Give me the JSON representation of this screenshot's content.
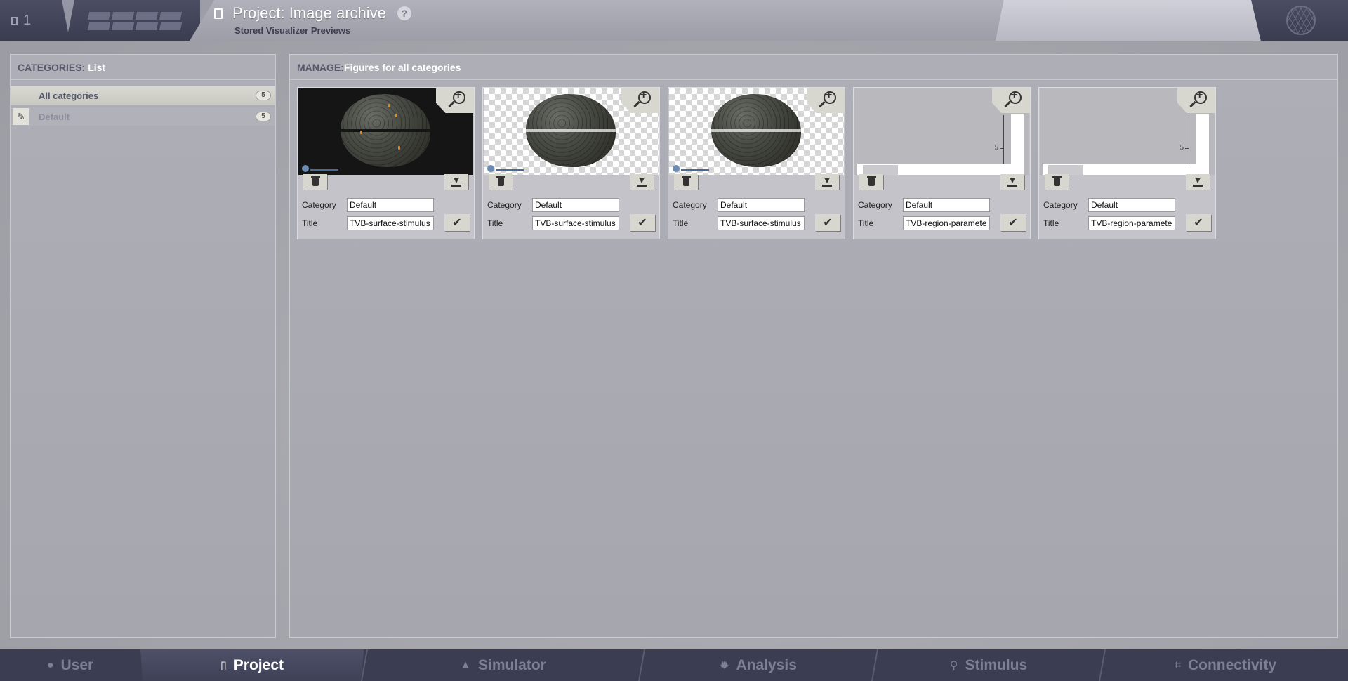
{
  "header": {
    "project_count": "1",
    "title": "Project: Image archive",
    "subtitle": "Stored Visualizer Previews",
    "help_glyph": "?"
  },
  "categories": {
    "heading_key": "CATEGORIES:",
    "heading_value": "List",
    "items": [
      {
        "label": "All categories",
        "count": "5"
      },
      {
        "label": "Default",
        "count": "5"
      }
    ]
  },
  "manage": {
    "heading_key": "MANAGE:",
    "heading_value": "Figures for all categories",
    "category_label": "Category",
    "title_label": "Title",
    "figures": [
      {
        "category": "Default",
        "title": "TVB-surface-stimulus",
        "thumb": "dark-brain"
      },
      {
        "category": "Default",
        "title": "TVB-surface-stimulus",
        "thumb": "brain-transparent"
      },
      {
        "category": "Default",
        "title": "TVB-surface-stimulus",
        "thumb": "brain-transparent"
      },
      {
        "category": "Default",
        "title": "TVB-region-parameters",
        "thumb": "plot",
        "tick_label": "5"
      },
      {
        "category": "Default",
        "title": "TVB-region-parameters",
        "thumb": "plot",
        "tick_label": "5"
      }
    ]
  },
  "footer": {
    "tabs": [
      {
        "label": "User",
        "icon": "user-icon"
      },
      {
        "label": "Project",
        "icon": "document-icon"
      },
      {
        "label": "Simulator",
        "icon": "rocket-icon"
      },
      {
        "label": "Analysis",
        "icon": "gear-icon"
      },
      {
        "label": "Stimulus",
        "icon": "pin-icon"
      },
      {
        "label": "Connectivity",
        "icon": "network-icon"
      }
    ],
    "active_tab": "Project"
  },
  "colors": {
    "header_dark": "#3a3c50",
    "footer": "#3b3d52",
    "panel_bg": "#aaaab2",
    "button_bg": "#d7d6cf"
  }
}
